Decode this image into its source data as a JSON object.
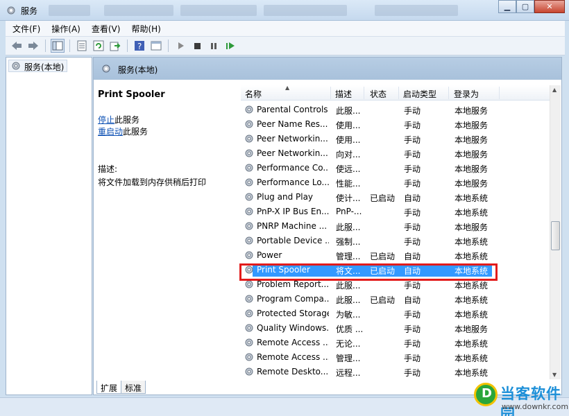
{
  "window": {
    "title": "服务",
    "buttons": {
      "minimize": "▁",
      "maximize": "▢",
      "close": "✕"
    }
  },
  "menu": [
    "文件(F)",
    "操作(A)",
    "查看(V)",
    "帮助(H)"
  ],
  "toolbar": {
    "icons": [
      "back-icon",
      "forward-icon",
      "show-hide-tree-icon",
      "properties-icon",
      "refresh-icon",
      "export-icon",
      "help-icon",
      "console-icon",
      "start-icon",
      "stop-icon",
      "pause-icon",
      "restart-icon"
    ]
  },
  "tree": {
    "root_label": "服务(本地)"
  },
  "main": {
    "header_title": "服务(本地)",
    "selected_service": "Print Spooler",
    "stop_link": "停止",
    "stop_suffix": "此服务",
    "restart_link": "重启动",
    "restart_suffix": "此服务",
    "description_label": "描述:",
    "description_text": "将文件加载到内存供稍后打印"
  },
  "list": {
    "columns": [
      "名称",
      "描述",
      "状态",
      "启动类型",
      "登录为"
    ],
    "rows": [
      [
        "Parental Controls",
        "此服...",
        "",
        "手动",
        "本地服务"
      ],
      [
        "Peer Name Res...",
        "使用...",
        "",
        "手动",
        "本地服务"
      ],
      [
        "Peer Networkin...",
        "使用...",
        "",
        "手动",
        "本地服务"
      ],
      [
        "Peer Networkin...",
        "向对...",
        "",
        "手动",
        "本地服务"
      ],
      [
        "Performance Co...",
        "使远...",
        "",
        "手动",
        "本地服务"
      ],
      [
        "Performance Lo...",
        "性能...",
        "",
        "手动",
        "本地服务"
      ],
      [
        "Plug and Play",
        "使计...",
        "已启动",
        "自动",
        "本地系统"
      ],
      [
        "PnP-X IP Bus En...",
        "PnP-...",
        "",
        "手动",
        "本地系统"
      ],
      [
        "PNRP Machine ...",
        "此服...",
        "",
        "手动",
        "本地服务"
      ],
      [
        "Portable Device ...",
        "强制...",
        "",
        "手动",
        "本地系统"
      ],
      [
        "Power",
        "管理...",
        "已启动",
        "自动",
        "本地系统"
      ],
      [
        "Print Spooler",
        "将文...",
        "已启动",
        "自动",
        "本地系统"
      ],
      [
        "Problem Report...",
        "此服...",
        "",
        "手动",
        "本地系统"
      ],
      [
        "Program Compa...",
        "此服...",
        "已启动",
        "自动",
        "本地系统"
      ],
      [
        "Protected Storage",
        "为敏...",
        "",
        "手动",
        "本地系统"
      ],
      [
        "Quality Windows...",
        "优质 ...",
        "",
        "手动",
        "本地服务"
      ],
      [
        "Remote Access ...",
        "无论...",
        "",
        "手动",
        "本地系统"
      ],
      [
        "Remote Access ...",
        "管理...",
        "",
        "手动",
        "本地系统"
      ],
      [
        "Remote Deskto...",
        "远程...",
        "",
        "手动",
        "本地系统"
      ]
    ],
    "selected_index": 11
  },
  "tabs": [
    "扩展",
    "标准"
  ],
  "watermark": {
    "title": "当客软件园",
    "url": "www.downkr.com"
  },
  "colors": {
    "selection": "#3399ff",
    "highlight_box": "#e21b1b",
    "link": "#0b4fb3"
  }
}
